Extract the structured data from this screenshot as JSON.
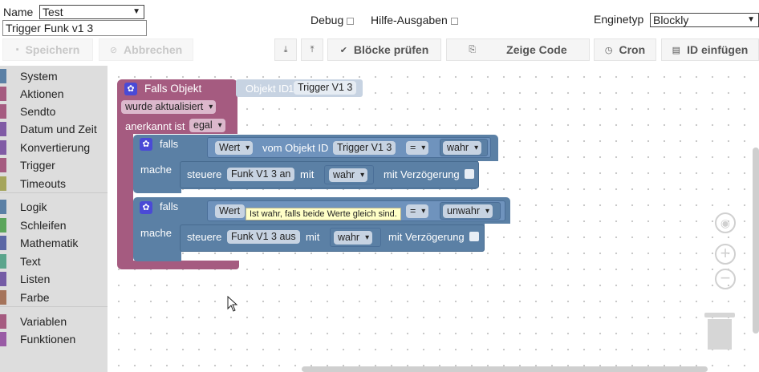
{
  "form": {
    "name_label": "Name",
    "name_value": "Test",
    "script_name": "Trigger Funk v1 3",
    "debug_label": "Debug",
    "hilfe_label": "Hilfe-Ausgaben",
    "enginetyp_label": "Enginetyp",
    "enginetyp_value": "Blockly"
  },
  "toolbar": {
    "save": "Speichern",
    "cancel": "Abbrechen",
    "check_blocks": "Blöcke prüfen",
    "show_code": "Zeige Code",
    "cron": "Cron",
    "insert_id": "ID einfügen"
  },
  "toolbox": [
    {
      "label": "System",
      "color": "#5b80a5"
    },
    {
      "label": "Aktionen",
      "color": "#a55b80"
    },
    {
      "label": "Sendto",
      "color": "#a55b80"
    },
    {
      "label": "Datum und Zeit",
      "color": "#805ba5"
    },
    {
      "label": "Konvertierung",
      "color": "#805ba5"
    },
    {
      "label": "Trigger",
      "color": "#a55b80"
    },
    {
      "label": "Timeouts",
      "color": "#a5a55b"
    },
    {
      "label": "Logik",
      "color": "#5b80a5"
    },
    {
      "label": "Schleifen",
      "color": "#5ba55b"
    },
    {
      "label": "Mathematik",
      "color": "#5b67a5"
    },
    {
      "label": "Text",
      "color": "#5ba58c"
    },
    {
      "label": "Listen",
      "color": "#745ba5"
    },
    {
      "label": "Farbe",
      "color": "#a5745b"
    },
    {
      "label": "Variablen",
      "color": "#a55b80"
    },
    {
      "label": "Funktionen",
      "color": "#995ba5"
    }
  ],
  "blocks": {
    "trigger": {
      "title": "Falls Objekt",
      "objekt_id_label": "Objekt ID",
      "objekt_id_value": "Trigger V1 3",
      "event": "wurde aktualisiert",
      "ack_label": "anerkannt ist",
      "ack_value": "egal"
    },
    "if1": {
      "falls": "falls",
      "mache": "mache",
      "wert": "Wert",
      "vom_objekt": "vom Objekt ID",
      "object": "Trigger V1 3",
      "op": "=",
      "value": "wahr",
      "steuere": "steuere",
      "target": "Funk V1 3 an",
      "mit": "mit",
      "set_value": "wahr",
      "delay": "mit Verzögerung"
    },
    "if2": {
      "falls": "falls",
      "mache": "mache",
      "wert": "Wert",
      "op": "=",
      "value": "unwahr",
      "steuere": "steuere",
      "target": "Funk V1 3 aus",
      "mit": "mit",
      "set_value": "wahr",
      "delay": "mit Verzögerung"
    },
    "tooltip": "Ist wahr, falls beide Werte gleich sind."
  },
  "colors": {
    "trigger_block": "#a55b80",
    "logic_block": "#5b80a5",
    "objekt_block": "#c7d3e2",
    "toolbox_bg": "#dddddd"
  }
}
